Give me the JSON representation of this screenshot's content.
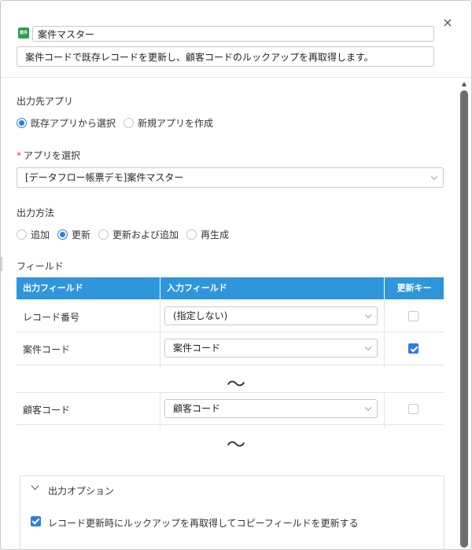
{
  "header": {
    "app_icon_text": "案件",
    "title_value": "案件マスター",
    "description_value": "案件コードで既存レコードを更新し、顧客コードのルックアップを再取得します。",
    "close_glyph": "×"
  },
  "output_app": {
    "label": "出力先アプリ",
    "options": [
      "既存アプリから選択",
      "新規アプリを作成"
    ],
    "selected_index": 0
  },
  "select_app": {
    "required_mark": "*",
    "label": "アプリを選択",
    "value": "[データフロー帳票デモ]案件マスター"
  },
  "output_method": {
    "label": "出力方法",
    "options": [
      "追加",
      "更新",
      "更新および追加",
      "再生成"
    ],
    "selected_index": 1
  },
  "fields": {
    "label": "フィールド",
    "columns": [
      "出力フィールド",
      "入力フィールド",
      "更新キー"
    ],
    "rows": [
      {
        "output": "レコード番号",
        "input": "(指定しない)",
        "key": false
      },
      {
        "output": "案件コード",
        "input": "案件コード",
        "key": true
      },
      {
        "output": "顧客コード",
        "input": "顧客コード",
        "key": false
      }
    ],
    "ellipsis": "〜"
  },
  "output_options": {
    "label": "出力オプション",
    "checkbox_label": "レコード更新時にルックアップを再取得してコピーフィールドを更新する",
    "checked": true
  },
  "colors": {
    "accent": "#2f7de1",
    "table_header": "#2f96dc",
    "app_icon": "#2e9e4f"
  }
}
